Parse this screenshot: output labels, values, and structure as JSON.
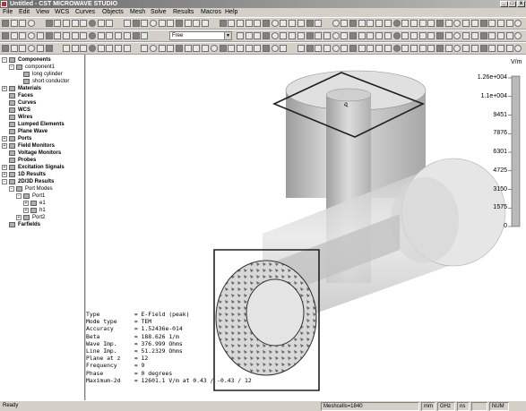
{
  "window": {
    "title": "Untitled - CST MICROWAVE STUDIO"
  },
  "menu": [
    "File",
    "Edit",
    "View",
    "WCS",
    "Curves",
    "Objects",
    "Mesh",
    "Solve",
    "Results",
    "Macros",
    "Help"
  ],
  "toolbar": {
    "mode_select": "Free"
  },
  "tree": {
    "items": [
      {
        "label": "Components",
        "level": 0,
        "exp": "-",
        "bold": true
      },
      {
        "label": "component1",
        "level": 1,
        "exp": "-",
        "bold": false
      },
      {
        "label": "long cylinder",
        "level": 2,
        "exp": "",
        "bold": false
      },
      {
        "label": "short conductor",
        "level": 2,
        "exp": "",
        "bold": false
      },
      {
        "label": "Materials",
        "level": 0,
        "exp": "+",
        "bold": true
      },
      {
        "label": "Faces",
        "level": 0,
        "exp": "",
        "bold": true
      },
      {
        "label": "Curves",
        "level": 0,
        "exp": "",
        "bold": true
      },
      {
        "label": "WCS",
        "level": 0,
        "exp": "",
        "bold": true
      },
      {
        "label": "Wires",
        "level": 0,
        "exp": "",
        "bold": true
      },
      {
        "label": "Lumped Elements",
        "level": 0,
        "exp": "",
        "bold": true
      },
      {
        "label": "Plane Wave",
        "level": 0,
        "exp": "",
        "bold": true
      },
      {
        "label": "Ports",
        "level": 0,
        "exp": "+",
        "bold": true
      },
      {
        "label": "Field Monitors",
        "level": 0,
        "exp": "+",
        "bold": true
      },
      {
        "label": "Voltage Monitors",
        "level": 0,
        "exp": "",
        "bold": true
      },
      {
        "label": "Probes",
        "level": 0,
        "exp": "",
        "bold": true
      },
      {
        "label": "Excitation Signals",
        "level": 0,
        "exp": "+",
        "bold": true
      },
      {
        "label": "1D Results",
        "level": 0,
        "exp": "+",
        "bold": true
      },
      {
        "label": "2D/3D Results",
        "level": 0,
        "exp": "-",
        "bold": true
      },
      {
        "label": "Port Modes",
        "level": 1,
        "exp": "-",
        "bold": false
      },
      {
        "label": "Port1",
        "level": 2,
        "exp": "-",
        "bold": false
      },
      {
        "label": "e1",
        "level": 3,
        "exp": "+",
        "bold": false
      },
      {
        "label": "h1",
        "level": 3,
        "exp": "+",
        "bold": false
      },
      {
        "label": "Port2",
        "level": 2,
        "exp": "+",
        "bold": false
      },
      {
        "label": "Farfields",
        "level": 0,
        "exp": "",
        "bold": true
      }
    ]
  },
  "info": {
    "lines": [
      "Type          = E-Field (peak)",
      "Mode type     = TEM",
      "Accuracy      = 1.52436e-014",
      "Beta          = 188.626 1/m",
      "Wave Imp.     = 376.999 Ohms",
      "Line Imp.     = 51.2329 Ohms",
      "",
      "Plane at z    = 12",
      "Frequency     = 9",
      "Phase         = 0 degrees",
      "Maximum-2d    = 12601.1 V/m at 0.43 / -0.43 / 12"
    ]
  },
  "legend": {
    "unit": "V/m",
    "labels": [
      "1.26e+004",
      "1.1e+004",
      "9451",
      "7876",
      "6301",
      "4725",
      "3150",
      "1575",
      "0"
    ]
  },
  "status": {
    "ready": "Ready",
    "meshcells": "Meshcells=1840",
    "units": [
      "mm",
      "GHz",
      "ns"
    ],
    "num": "NUM"
  }
}
